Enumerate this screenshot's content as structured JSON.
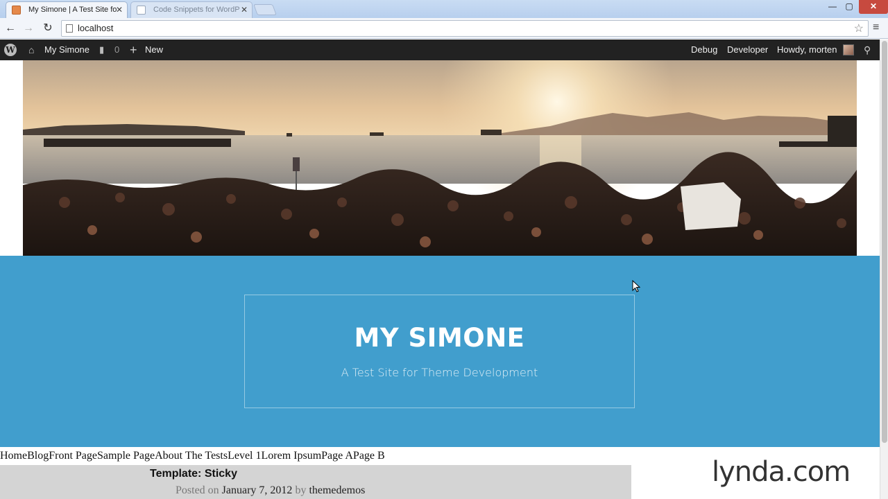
{
  "browser": {
    "tabs": [
      {
        "label": "My Simone | A Test Site fo",
        "active": true
      },
      {
        "label": "Code Snippets for WordP",
        "active": false
      }
    ],
    "window_controls": {
      "minimize": "—",
      "maximize": "▢",
      "close": "✕"
    },
    "url": "localhost",
    "nav": {
      "back": "←",
      "forward": "→",
      "reload": "↻",
      "star": "☆",
      "menu": "≡"
    }
  },
  "adminbar": {
    "site_name": "My Simone",
    "comments_count": "0",
    "new_label": "New",
    "debug_label": "Debug",
    "developer_label": "Developer",
    "howdy_label": "Howdy, morten",
    "icons": {
      "wp": "W",
      "home": "⌂",
      "comments": "▮",
      "plus": "+",
      "search": "⚲"
    }
  },
  "site": {
    "title": "MY SIMONE",
    "description": "A Test Site for Theme Development"
  },
  "menu": {
    "items": [
      "Home",
      "Blog",
      "Front Page",
      "Sample Page",
      "About The Tests",
      "Level 1",
      "Lorem Ipsum",
      "Page A",
      "Page B"
    ]
  },
  "post": {
    "title": "Template: Sticky",
    "posted_on_label": "Posted on",
    "date": "January 7, 2012",
    "by_label": "by",
    "author": "themedemos"
  },
  "watermark": "lynda.com",
  "colors": {
    "header_blue": "#419ecd",
    "adminbar": "#222222",
    "post_bg": "#d4d4d4"
  }
}
